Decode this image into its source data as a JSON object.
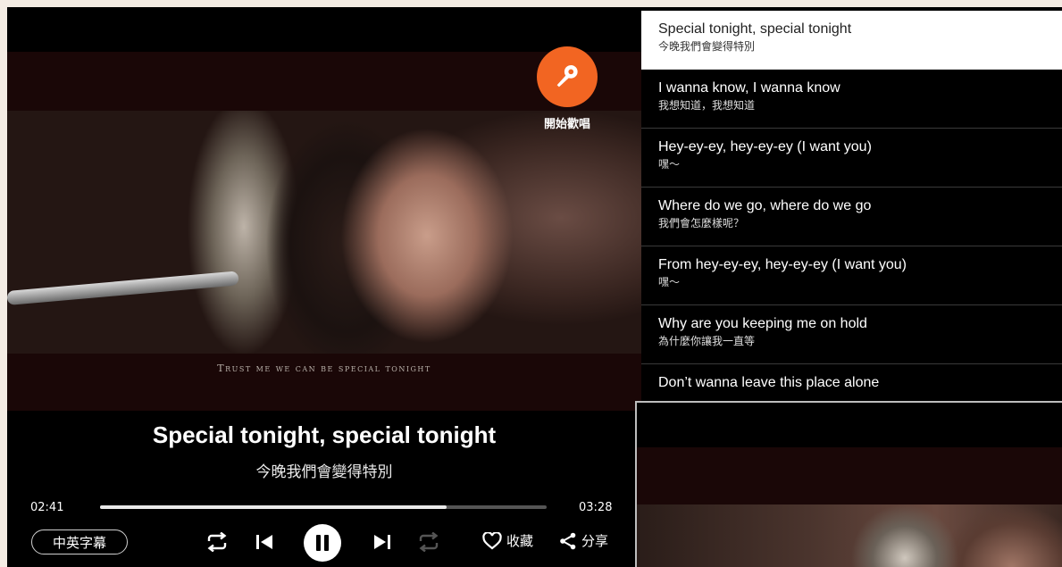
{
  "player": {
    "video_caption": "Trust me we can be special tonight",
    "sing_button_label": "開始歡唱",
    "current_lyric_en": "Special tonight, special tonight",
    "current_lyric_zh": "今晚我們會變得特別",
    "time_current": "02:41",
    "time_total": "03:28",
    "progress_fraction": 0.775,
    "subtitle_mode_label": "中英字幕",
    "favorite_label": "收藏",
    "share_label": "分享",
    "accent_color": "#f26522"
  },
  "lyrics": [
    {
      "en": "Special tonight, special tonight",
      "zh": "今晚我們會變得特別",
      "active": true
    },
    {
      "en": "I wanna know, I wanna know",
      "zh": "我想知道，我想知道",
      "active": false
    },
    {
      "en": "Hey-ey-ey, hey-ey-ey (I want you)",
      "zh": "嘿～",
      "active": false
    },
    {
      "en": "Where do we go, where do we go",
      "zh": "我們會怎麼樣呢？",
      "active": false
    },
    {
      "en": "From hey-ey-ey, hey-ey-ey (I want you)",
      "zh": "嘿～",
      "active": false
    },
    {
      "en": "Why are you keeping me on hold",
      "zh": "為什麼你讓我一直等",
      "active": false
    },
    {
      "en": "Don’t wanna leave this place alone",
      "zh": "",
      "active": false
    }
  ]
}
